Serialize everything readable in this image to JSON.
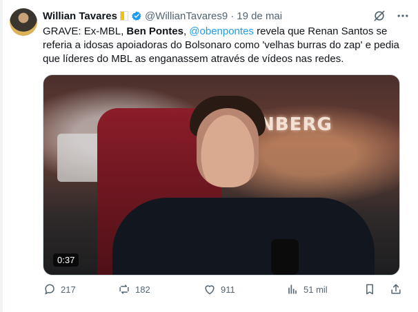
{
  "author": {
    "name": "Willian Tavares",
    "handle": "@WillianTavares9",
    "date": "19 de mai"
  },
  "tweet": {
    "text_prefix": "GRAVE: Ex-MBL, ",
    "bold": "Ben Pontes",
    "comma": ", ",
    "mention": "@obenpontes",
    "text_suffix": " revela que Renan Santos se referia a idosas apoiadoras do Bolsonaro como 'velhas burras do zap' e pedia que líderes do MBL as enganassem através de vídeos nas redes."
  },
  "media": {
    "duration": "0:37",
    "sign_text": "ONBERG"
  },
  "actions": {
    "replies": "217",
    "reposts": "182",
    "likes": "911",
    "views": "51 mil"
  },
  "colors": {
    "text": "#0f1419",
    "muted": "#536471",
    "link": "#1d9bf0",
    "verified": "#1d9bf0"
  },
  "icons": {
    "header": [
      "grok-icon",
      "more-icon"
    ],
    "actions": [
      "reply-icon",
      "repost-icon",
      "like-icon",
      "views-icon",
      "bookmark-icon",
      "share-icon"
    ]
  }
}
